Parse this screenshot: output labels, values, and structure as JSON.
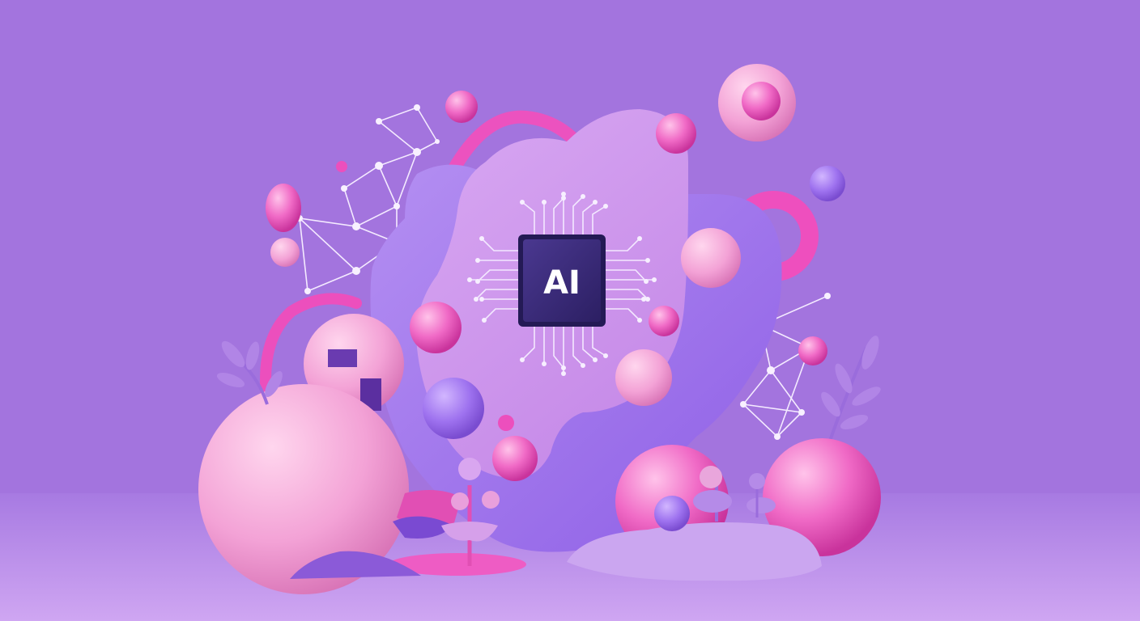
{
  "chip": {
    "label": "AI"
  },
  "colors": {
    "background": "#a374de",
    "floor": "#c7a0ef",
    "blob_lavender": "#b98cf0",
    "blob_violet": "#9d6df0",
    "pink_hot": "#ec4fbd",
    "pink_soft": "#f3a8d8",
    "chip_dark": "#3a2a7a",
    "circuit_line": "#f3e8ff"
  },
  "icons": {
    "chip": "microchip-icon",
    "network": "network-graph-icon",
    "leaf": "leaf-sprig-icon",
    "flower": "flower-sprout-icon"
  }
}
